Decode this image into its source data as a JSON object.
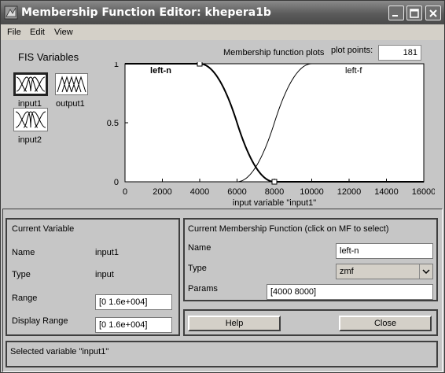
{
  "window": {
    "title": "Membership Function Editor: khepera1b"
  },
  "menu": [
    "File",
    "Edit",
    "View"
  ],
  "fis": {
    "heading": "FIS Variables",
    "variables": [
      {
        "label": "input1",
        "selected": true
      },
      {
        "label": "output1",
        "selected": false
      },
      {
        "label": "input2",
        "selected": false
      }
    ]
  },
  "plot": {
    "title": "Membership function plots",
    "plot_points_label": "plot points:",
    "plot_points_value": "181"
  },
  "chart_data": {
    "type": "line",
    "xlabel": "input variable \"input1\"",
    "xlim": [
      0,
      16000
    ],
    "ylim": [
      0,
      1
    ],
    "xticks": [
      0,
      2000,
      4000,
      6000,
      8000,
      10000,
      12000,
      14000,
      16000
    ],
    "yticks": [
      0,
      0.5,
      1
    ],
    "series": [
      {
        "name": "left-n",
        "shape": "zmf",
        "params": [
          4000,
          8000
        ],
        "selected": true
      },
      {
        "name": "left-f",
        "shape": "smf",
        "params": [
          6000,
          10000
        ],
        "selected": false
      }
    ]
  },
  "current_variable": {
    "heading": "Current Variable",
    "name_label": "Name",
    "name_value": "input1",
    "type_label": "Type",
    "type_value": "input",
    "range_label": "Range",
    "range_value": "[0 1.6e+004]",
    "display_range_label": "Display Range",
    "display_range_value": "[0 1.6e+004]"
  },
  "current_mf": {
    "heading": "Current Membership Function (click on MF to select)",
    "name_label": "Name",
    "name_value": "left-n",
    "type_label": "Type",
    "type_value": "zmf",
    "params_label": "Params",
    "params_value": "[4000 8000]"
  },
  "buttons": {
    "help": "Help",
    "close": "Close"
  },
  "status": "Selected variable \"input1\"",
  "colors": {
    "title_bar": "#5b5b5b",
    "face": "#c6c6c6",
    "plot_bg": "#ffffff"
  }
}
